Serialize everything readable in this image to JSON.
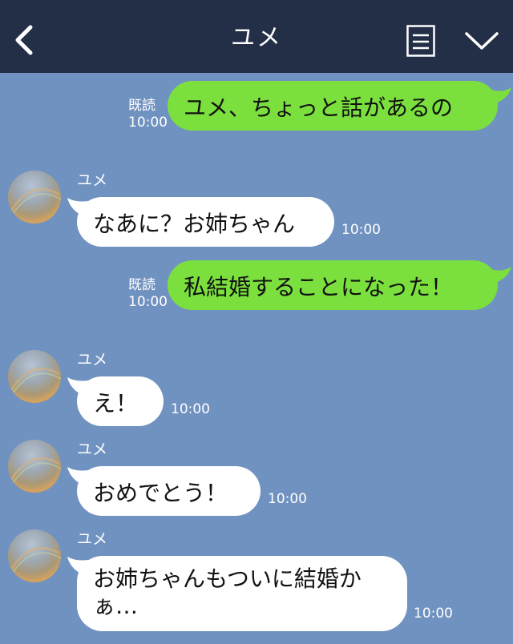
{
  "header": {
    "title": "ユメ",
    "back_icon": "chevron-left-icon",
    "memo_icon": "note-icon",
    "menu_icon": "chevron-down-icon"
  },
  "messages": [
    {
      "from": "me",
      "read_label": "既読",
      "time": "10:00",
      "text": "ユメ、ちょっと話があるの"
    },
    {
      "from": "them",
      "sender": "ユメ",
      "time": "10:00",
      "text": "なあに？お姉ちゃん"
    },
    {
      "from": "me",
      "read_label": "既読",
      "time": "10:00",
      "text": "私結婚することになった！"
    },
    {
      "from": "them",
      "sender": "ユメ",
      "time": "10:00",
      "text": "え！"
    },
    {
      "from": "them",
      "sender": "ユメ",
      "time": "10:00",
      "text": "おめでとう！"
    },
    {
      "from": "them",
      "sender": "ユメ",
      "time": "10:00",
      "text_line1": "お姉ちゃんもついに結婚か",
      "text_line2": "ぁ…"
    }
  ],
  "colors": {
    "header_bg": "#232e47",
    "chat_bg": "#7092c0",
    "my_bubble": "#7be03e",
    "their_bubble": "#ffffff"
  }
}
